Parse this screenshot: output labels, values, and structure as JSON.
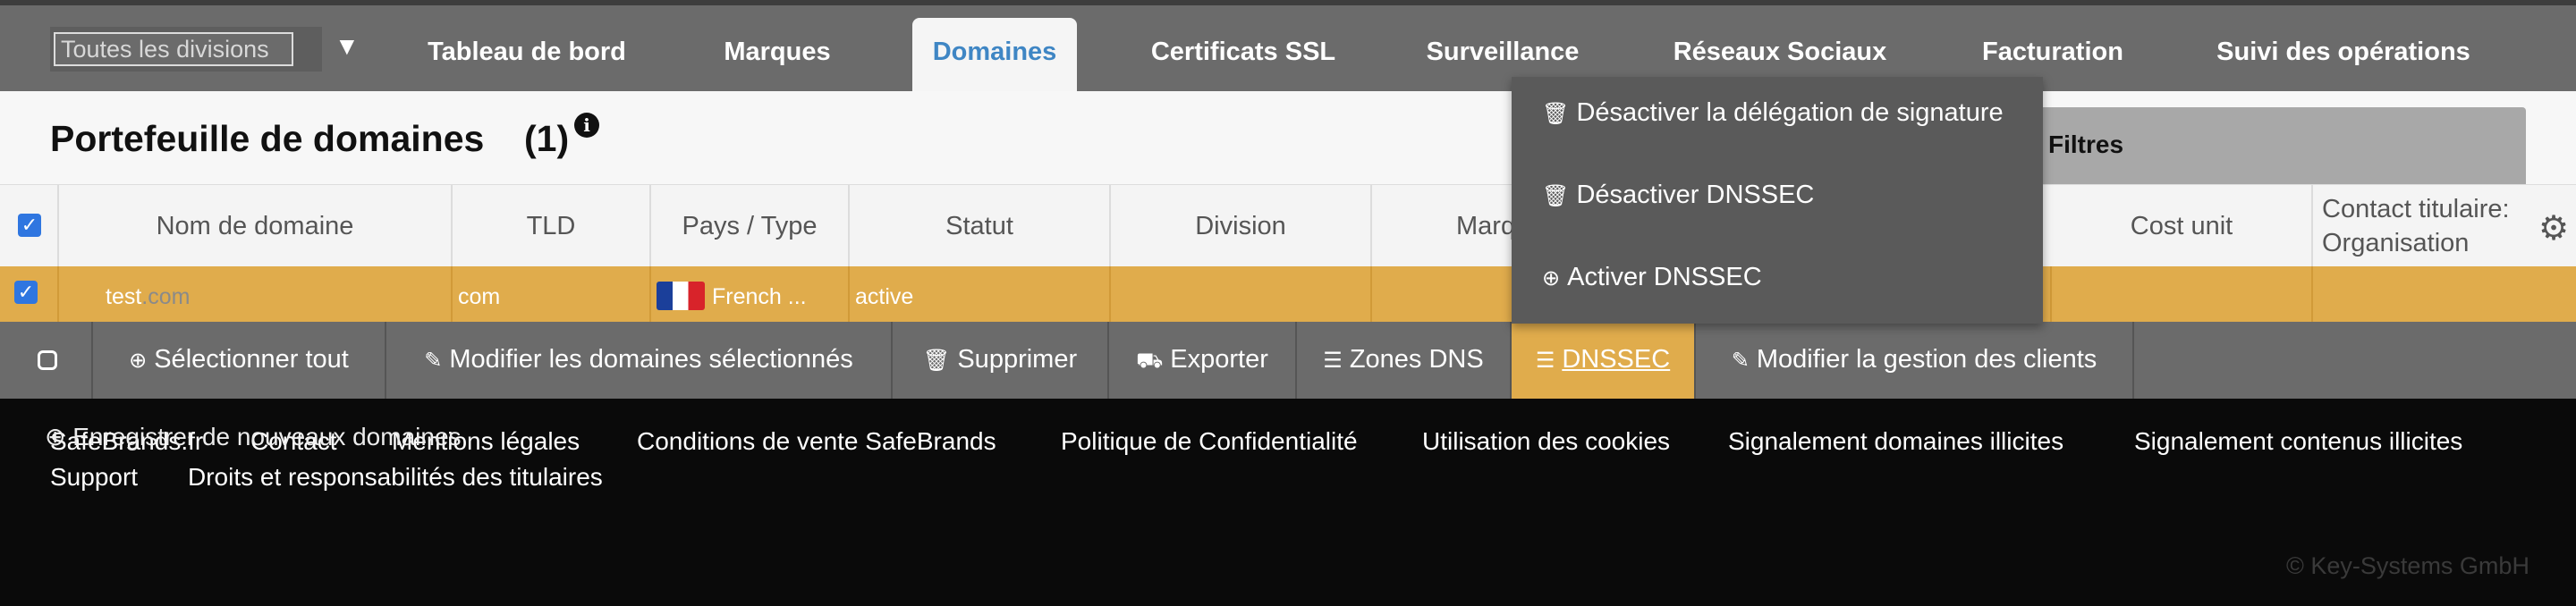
{
  "nav": {
    "division_select": "Toutes les divisions",
    "tabs": [
      {
        "label": "Tableau de bord"
      },
      {
        "label": "Marques"
      },
      {
        "label": "Domaines"
      },
      {
        "label": "Certificats SSL"
      },
      {
        "label": "Surveillance"
      },
      {
        "label": "Réseaux Sociaux"
      },
      {
        "label": "Facturation"
      },
      {
        "label": "Suivi des opérations"
      }
    ],
    "active_tab": "Domaines"
  },
  "header": {
    "title": "Portefeuille de domaines",
    "count": "(1)",
    "info_icon": "info-icon",
    "filters_label": "Filtres"
  },
  "table": {
    "columns": [
      "Nom de domaine",
      "TLD",
      "Pays / Type",
      "Statut",
      "Division",
      "Marq",
      "Cost unit",
      "Contact titulaire: Organisation"
    ],
    "rows": [
      {
        "domain_name": "test",
        "domain_tld": ".com",
        "tld": "com",
        "country": "French ...",
        "status": "active",
        "selected": true
      }
    ]
  },
  "actions": [
    {
      "label": "Sélectionner tout",
      "icon": "plus-circle-icon"
    },
    {
      "label": "Modifier les domaines sélectionnés",
      "icon": "pencil-icon"
    },
    {
      "label": "Supprimer",
      "icon": "trash-icon"
    },
    {
      "label": "Exporter",
      "icon": "truck-icon"
    },
    {
      "label": "Zones DNS",
      "icon": "list-icon"
    },
    {
      "label": "DNSSEC",
      "icon": "list-icon"
    },
    {
      "label": "Modifier la gestion des clients",
      "icon": "pencil-icon"
    }
  ],
  "active_action": "DNSSEC",
  "dnssec_menu": [
    {
      "label": "Désactiver la délégation de signature",
      "icon": "trash-icon"
    },
    {
      "label": "Désactiver DNSSEC",
      "icon": "trash-icon"
    },
    {
      "label": "Activer DNSSEC",
      "icon": "plus-circle-icon"
    }
  ],
  "register_link": "Enregistrer de nouveaux domaines",
  "footer": {
    "links_row1": [
      "SafeBrands.fr",
      "Contact",
      "Mentions légales",
      "Conditions de vente SafeBrands",
      "Politique de Confidentialité",
      "Utilisation des cookies",
      "Signalement domaines illicites",
      "Signalement contenus illicites"
    ],
    "links_row2": [
      "Support",
      "Droits et responsabilités des titulaires"
    ],
    "copyright": "© Key-Systems GmbH"
  },
  "colors": {
    "nav_bg": "#6b6b6b",
    "active_tab_text": "#3f86c4",
    "selected_row": "#e0ac4c",
    "menu_bg": "#5a5a5a",
    "footer_bg": "#0a0a0a"
  }
}
